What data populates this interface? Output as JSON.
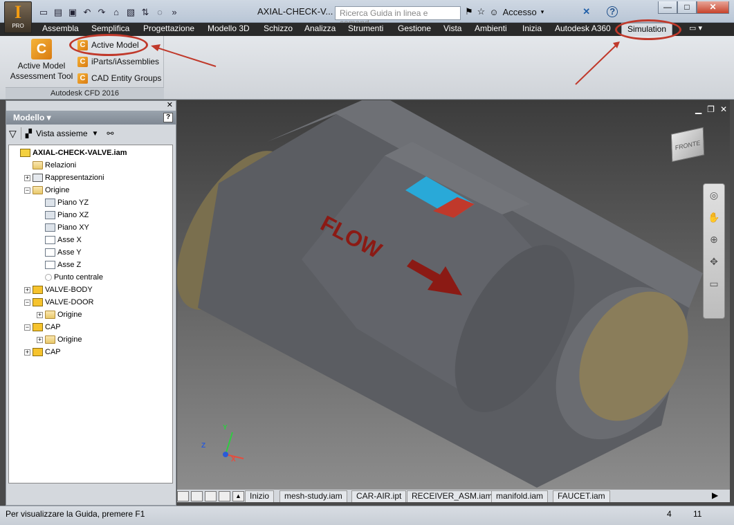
{
  "app": {
    "logo_letter": "I",
    "logo_edition": "PRO"
  },
  "window": {
    "title": "AXIAL-CHECK-V...",
    "search_placeholder": "Ricerca Guida in linea e comand",
    "signin_label": "Accesso",
    "help_label": "?"
  },
  "ribbon": {
    "tabs": [
      "Assembla",
      "Semplifica",
      "Progettazione",
      "Modello 3D",
      "Schizzo",
      "Analizza",
      "Strumenti",
      "Gestione",
      "Vista",
      "Ambienti",
      "Inizia",
      "Autodesk A360",
      "Simulation"
    ],
    "active_tab": "Simulation",
    "group": {
      "name": "Autodesk CFD 2016",
      "big_tool": {
        "line1": "Active Model",
        "line2": "Assessment Tool"
      },
      "small_tools": [
        "Active Model",
        "iParts/iAssemblies",
        "CAD Entity Groups"
      ]
    }
  },
  "browser": {
    "title": "Modello",
    "view_label": "Vista assieme",
    "tree": [
      {
        "label": "AXIAL-CHECK-VALVE.iam",
        "level": 0,
        "icon": "assembly-icon",
        "bold": true,
        "expander": ""
      },
      {
        "label": "Relazioni",
        "level": 1,
        "icon": "folder-icon",
        "expander": ""
      },
      {
        "label": "Rappresentazioni",
        "level": 1,
        "icon": "representations-icon",
        "expander": "+"
      },
      {
        "label": "Origine",
        "level": 1,
        "icon": "folder-open-icon",
        "expander": "−"
      },
      {
        "label": "Piano YZ",
        "level": 2,
        "icon": "plane-icon",
        "expander": ""
      },
      {
        "label": "Piano XZ",
        "level": 2,
        "icon": "plane-icon",
        "expander": ""
      },
      {
        "label": "Piano XY",
        "level": 2,
        "icon": "plane-icon",
        "expander": ""
      },
      {
        "label": "Asse X",
        "level": 2,
        "icon": "axis-icon",
        "expander": ""
      },
      {
        "label": "Asse Y",
        "level": 2,
        "icon": "axis-icon",
        "expander": ""
      },
      {
        "label": "Asse Z",
        "level": 2,
        "icon": "axis-icon",
        "expander": ""
      },
      {
        "label": "Punto centrale",
        "level": 2,
        "icon": "point-icon",
        "expander": ""
      },
      {
        "label": "VALVE-BODY",
        "level": 1,
        "icon": "part-icon",
        "expander": "+"
      },
      {
        "label": "VALVE-DOOR",
        "level": 1,
        "icon": "part-icon",
        "expander": "−"
      },
      {
        "label": "Origine",
        "level": 2,
        "icon": "folder-icon",
        "expander": "+"
      },
      {
        "label": "CAP",
        "level": 1,
        "icon": "part-icon",
        "expander": "−"
      },
      {
        "label": "Origine",
        "level": 2,
        "icon": "folder-icon",
        "expander": "+"
      },
      {
        "label": "CAP",
        "level": 1,
        "icon": "part-icon",
        "expander": "+"
      }
    ]
  },
  "viewport": {
    "model_text": "FLOW",
    "viewcube_label": "FRONTE",
    "triad": {
      "x": "X",
      "y": "Y",
      "z": "Z"
    },
    "colors": {
      "body": "#5f6166",
      "cap": "#8a7d5a",
      "flow_text": "#8b1a14",
      "logo_blue": "#29a9d8",
      "logo_red": "#c0392b"
    }
  },
  "doc_tabs": [
    "Inizio",
    "mesh-study.iam",
    "CAR-AIR.ipt",
    "RECEIVER_ASM.iam",
    "manifold.iam",
    "FAUCET.iam"
  ],
  "status": {
    "message": "Per visualizzare la Guida, premere F1",
    "count1": "4",
    "count2": "11"
  },
  "annotation_color": "#c0392b"
}
